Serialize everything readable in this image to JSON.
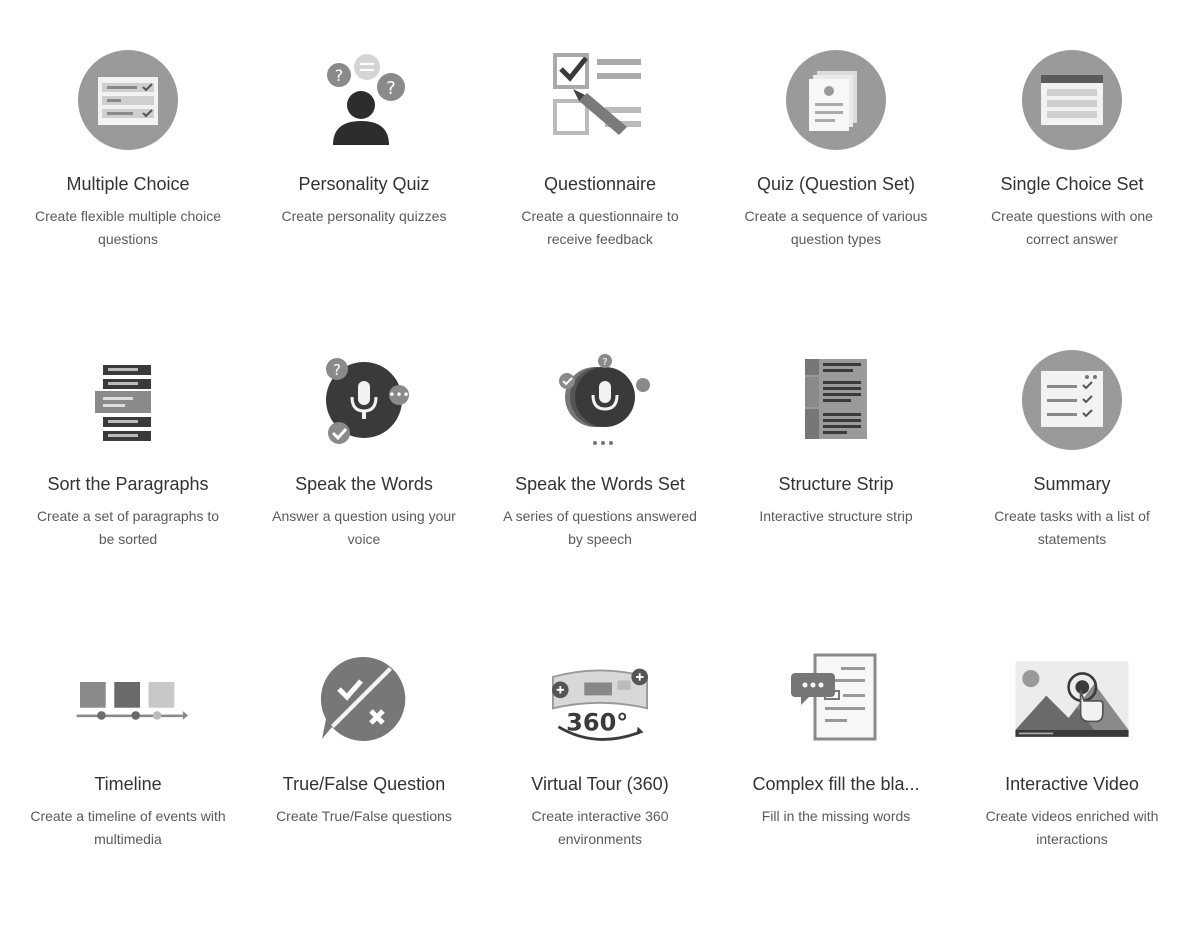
{
  "content_types": [
    {
      "icon": "multiple-choice-icon",
      "title": "Multiple Choice",
      "description": "Create flexible multiple choice questions"
    },
    {
      "icon": "personality-quiz-icon",
      "title": "Personality Quiz",
      "description": "Create personality quizzes"
    },
    {
      "icon": "questionnaire-icon",
      "title": "Questionnaire",
      "description": "Create a questionnaire to receive feedback"
    },
    {
      "icon": "question-set-icon",
      "title": "Quiz (Question Set)",
      "description": "Create a sequence of various question types"
    },
    {
      "icon": "single-choice-set-icon",
      "title": "Single Choice Set",
      "description": "Create questions with one correct answer"
    },
    {
      "icon": "sort-paragraphs-icon",
      "title": "Sort the Paragraphs",
      "description": "Create a set of paragraphs to be sorted"
    },
    {
      "icon": "speak-words-icon",
      "title": "Speak the Words",
      "description": "Answer a question using your voice"
    },
    {
      "icon": "speak-words-set-icon",
      "title": "Speak the Words Set",
      "description": "A series of questions answered by speech"
    },
    {
      "icon": "structure-strip-icon",
      "title": "Structure Strip",
      "description": "Interactive structure strip"
    },
    {
      "icon": "summary-icon",
      "title": "Summary",
      "description": "Create tasks with a list of statements"
    },
    {
      "icon": "timeline-icon",
      "title": "Timeline",
      "description": "Create a timeline of events with multimedia"
    },
    {
      "icon": "true-false-icon",
      "title": "True/False Question",
      "description": "Create True/False questions"
    },
    {
      "icon": "virtual-tour-360-icon",
      "title": "Virtual Tour (360)",
      "description": "Create interactive 360 environments"
    },
    {
      "icon": "fill-blanks-icon",
      "title": "Complex fill the bla...",
      "description": "Fill in the missing words"
    },
    {
      "icon": "interactive-video-icon",
      "title": "Interactive Video",
      "description": "Create videos enriched with interactions"
    }
  ]
}
